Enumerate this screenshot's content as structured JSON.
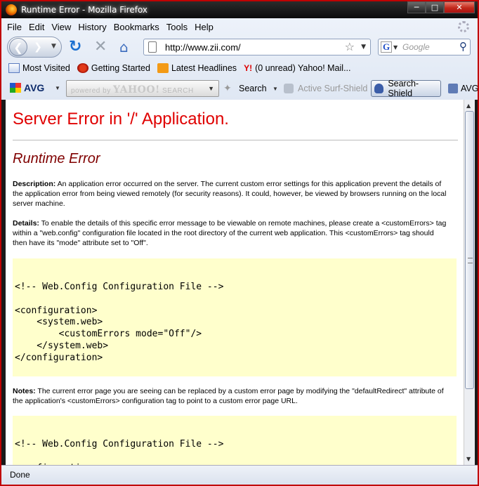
{
  "window": {
    "title": "Runtime Error - Mozilla Firefox"
  },
  "menu": [
    "File",
    "Edit",
    "View",
    "History",
    "Bookmarks",
    "Tools",
    "Help"
  ],
  "nav": {
    "url": "http://www.zii.com/",
    "search_placeholder": "Google"
  },
  "bookmarks": [
    "Most Visited",
    "Getting Started",
    "Latest Headlines",
    "(0 unread) Yahoo! Mail..."
  ],
  "avg": {
    "logo": "AVG",
    "yahoo_prefix": "powered by",
    "yahoo_brand": "YAHOO!",
    "yahoo_suffix": "SEARCH",
    "search_label": "Search",
    "surf_shield": "Active Surf-Shield",
    "search_shield": "Search-Shield",
    "more": "AVG"
  },
  "page": {
    "heading": "Server Error in '/' Application.",
    "subheading": "Runtime Error",
    "description_label": "Description:",
    "description_text": " An application error occurred on the server. The current custom error settings for this application prevent the details of the application error from being viewed remotely (for security reasons). It could, however, be viewed by browsers running on the local server machine.",
    "details_label": "Details:",
    "details_text": " To enable the details of this specific error message to be viewable on remote machines, please create a <customErrors> tag within a \"web.config\" configuration file located in the root directory of the current web application. This <customErrors> tag should then have its \"mode\" attribute set to \"Off\".",
    "code1": "<!-- Web.Config Configuration File -->\n\n<configuration>\n    <system.web>\n        <customErrors mode=\"Off\"/>\n    </system.web>\n</configuration>",
    "notes_label": "Notes:",
    "notes_text": " The current error page you are seeing can be replaced by a custom error page by modifying the \"defaultRedirect\" attribute of the application's <customErrors> configuration tag to point to a custom error page URL.",
    "code2": "<!-- Web.Config Configuration File -->\n\n<configuration>"
  },
  "status": {
    "text": "Done"
  }
}
